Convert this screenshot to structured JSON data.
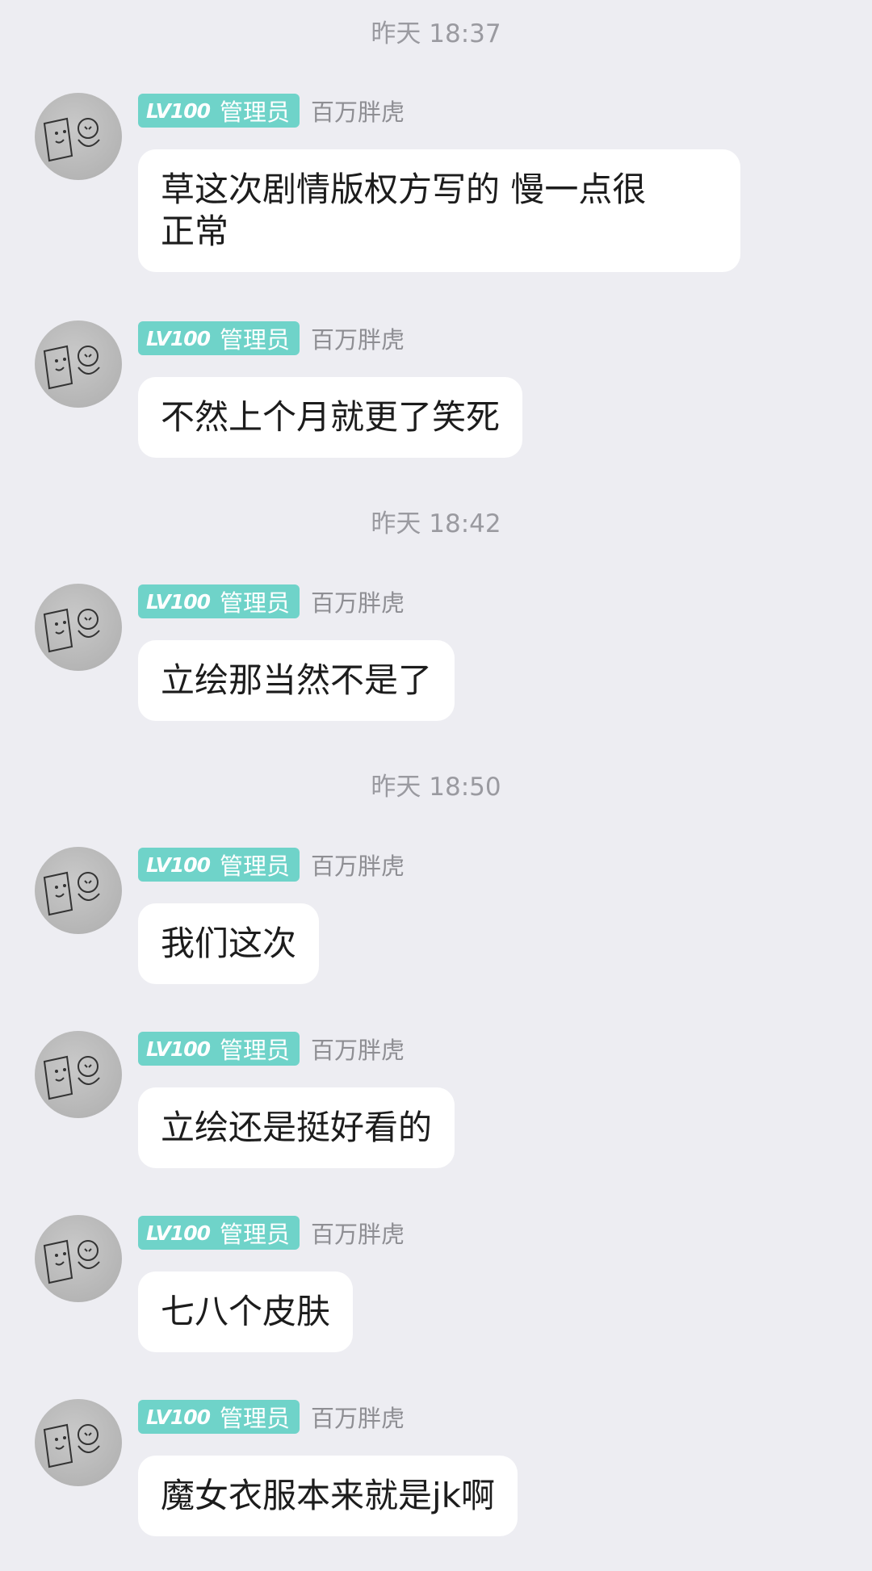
{
  "user": {
    "level": "LV100",
    "role": "管理员",
    "name": "百万胖虎"
  },
  "timestamps": [
    "昨天 18:37",
    "昨天 18:42",
    "昨天 18:50"
  ],
  "messages": [
    "草这次剧情版权方写的 慢一点很\n正常",
    "不然上个月就更了笑死",
    "立绘那当然不是了",
    "我们这次",
    "立绘还是挺好看的",
    "七八个皮肤",
    "魔女衣服本来就是jk啊"
  ],
  "colors": {
    "background": "#ededf2",
    "badge": "#6fd3c9",
    "bubble": "#ffffff",
    "timestamp": "#9a9aa0"
  }
}
